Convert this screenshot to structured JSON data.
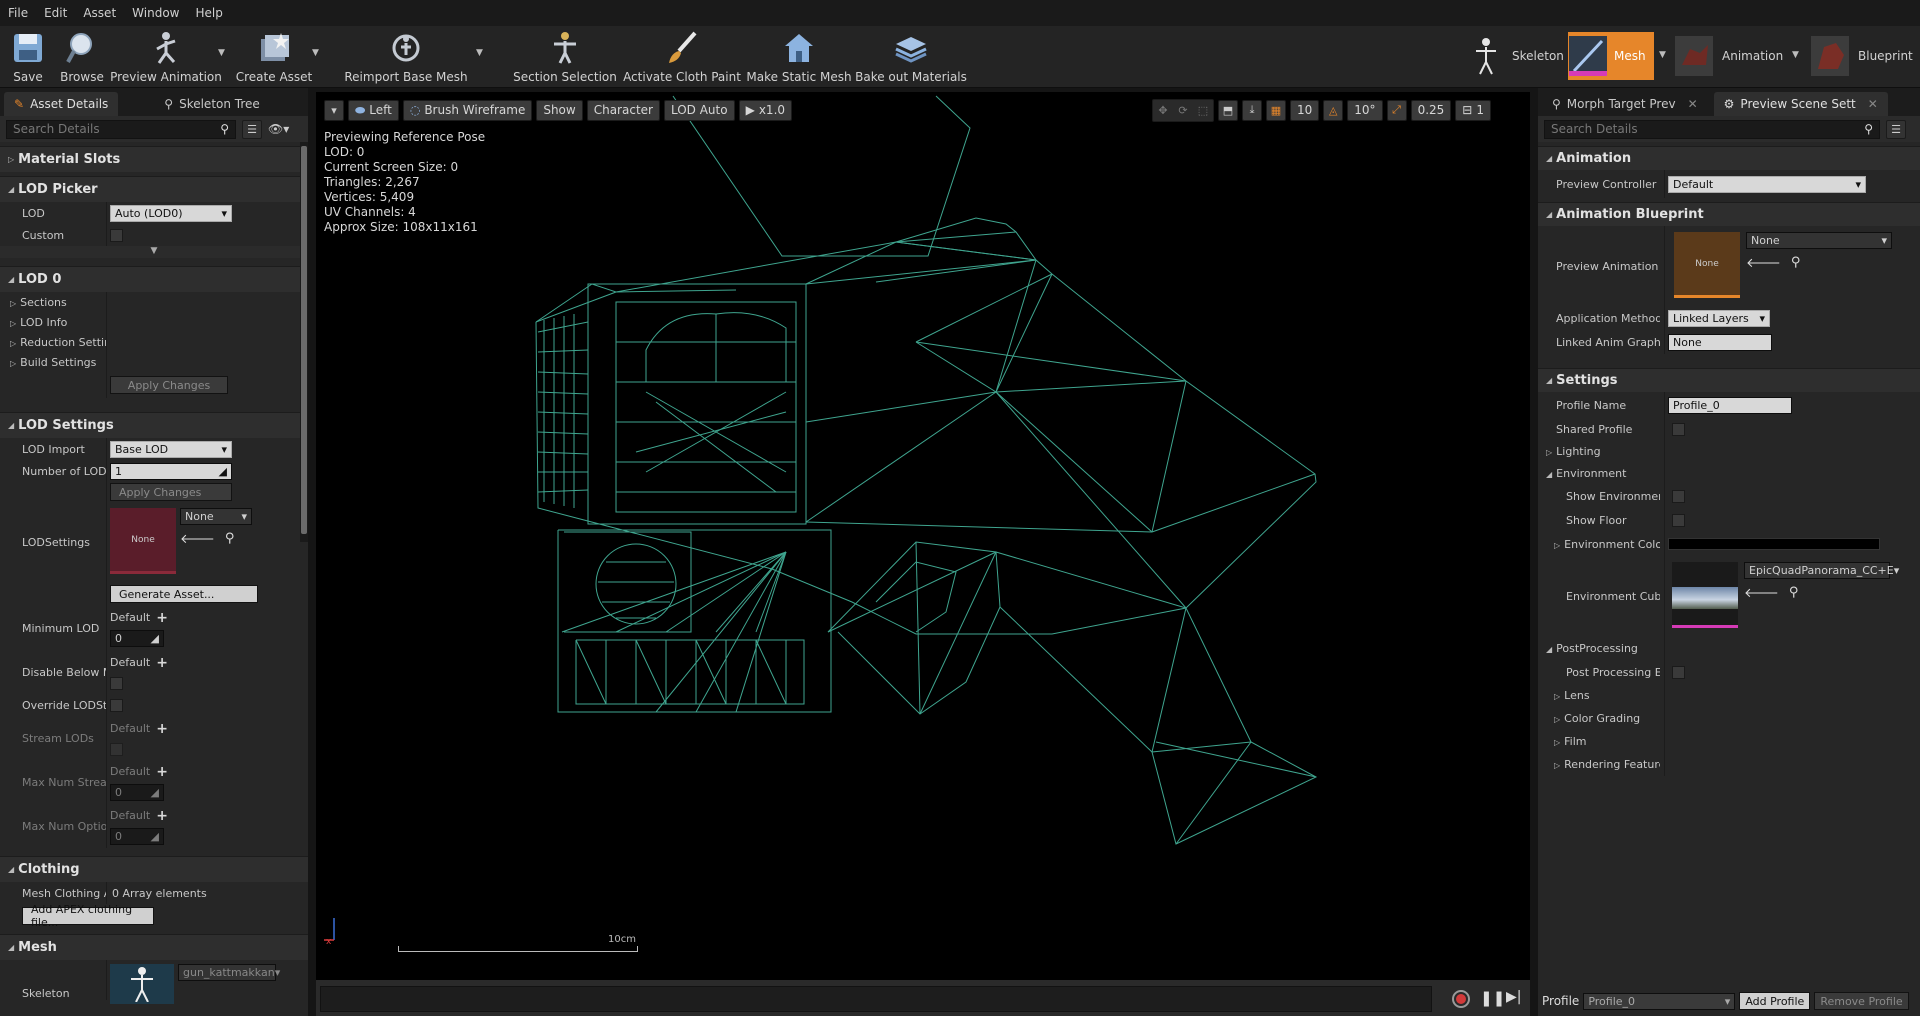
{
  "menu": [
    "File",
    "Edit",
    "Asset",
    "Window",
    "Help"
  ],
  "toolbar": {
    "save": "Save",
    "browse": "Browse",
    "preview_animation": "Preview Animation",
    "create_asset": "Create Asset",
    "reimport_base_mesh": "Reimport Base Mesh",
    "section_selection": "Section Selection",
    "activate_cloth_paint": "Activate Cloth Paint",
    "make_static_mesh": "Make Static Mesh",
    "bake_out_materials": "Bake out Materials"
  },
  "modes": {
    "skeleton": "Skeleton",
    "mesh": "Mesh",
    "animation": "Animation",
    "blueprint": "Blueprint"
  },
  "left": {
    "tabs": [
      "Asset Details",
      "Skeleton Tree"
    ],
    "search_placeholder": "Search Details",
    "material_slots": "Material Slots",
    "lod_picker": "LOD Picker",
    "lod_label": "LOD",
    "lod_value": "Auto (LOD0)",
    "custom_label": "Custom",
    "lod0": "LOD 0",
    "sections": "Sections",
    "lod_info": "LOD Info",
    "reduction_settings": "Reduction Settin",
    "build_settings": "Build Settings",
    "apply_changes": "Apply Changes",
    "lod_settings": "LOD Settings",
    "lod_import": "LOD Import",
    "lod_import_value": "Base LOD",
    "number_of_lods": "Number of LODs",
    "number_of_lods_value": "1",
    "apply_changes_2": "Apply Changes",
    "lodsettings": "LODSettings",
    "lodsettings_thumb": "None",
    "lodsettings_combo": "None",
    "generate_asset": "Generate Asset...",
    "minimum_lod": "Minimum LOD",
    "default": "Default",
    "minimum_lod_value": "0",
    "disable_below": "Disable Below M",
    "override_lodstr": "Override LODStr",
    "stream_lods": "Stream LODs",
    "max_num_stream": "Max Num Strean",
    "max_num_stream_value": "0",
    "max_num_optio": "Max Num Optior",
    "max_num_optio_value": "0",
    "clothing": "Clothing",
    "mesh_clothing": "Mesh Clothing A",
    "array_elements": "0 Array elements",
    "add_apex": "Add APEX clothing file...",
    "mesh": "Mesh",
    "skeleton": "Skeleton",
    "skeleton_value": "gun_kattmakkan"
  },
  "viewport": {
    "view_mode": "Left",
    "wireframe": "Brush Wireframe",
    "show": "Show",
    "character": "Character",
    "lod_auto": "LOD Auto",
    "speed": "x1.0",
    "grid_snap": "10",
    "rot_snap": "10°",
    "scale_snap": "0.25",
    "cam_speed": "1",
    "stats": [
      "Previewing Reference Pose",
      "LOD: 0",
      "Current Screen Size: 0",
      "Triangles: 2,267",
      "Vertices: 5,409",
      "UV Channels: 4",
      "Approx Size: 108x11x161"
    ],
    "scale_label": "10cm"
  },
  "right": {
    "tabs": [
      "Morph Target Prev",
      "Preview Scene Sett"
    ],
    "search_placeholder": "Search Details",
    "animation": "Animation",
    "preview_controller": "Preview Controller",
    "preview_controller_value": "Default",
    "animation_blueprint": "Animation Blueprint",
    "preview_anim_bp": "Preview Animation Blu",
    "anim_thumb": "None",
    "anim_combo": "None",
    "application_method": "Application Method",
    "application_method_value": "Linked Layers",
    "linked_anim_graph": "Linked Anim Graph Ta",
    "linked_anim_graph_value": "None",
    "settings": "Settings",
    "profile_name": "Profile Name",
    "profile_name_value": "Profile_0",
    "shared_profile": "Shared Profile",
    "lighting": "Lighting",
    "environment": "Environment",
    "show_environment": "Show Environment",
    "show_floor": "Show Floor",
    "environment_color": "Environment Color",
    "environment_cube": "Environment Cube M",
    "environment_cube_value": "EpicQuadPanorama_CC+E",
    "postprocessing": "PostProcessing",
    "post_processing_enabled": "Post Processing Ena",
    "lens": "Lens",
    "color_grading": "Color Grading",
    "film": "Film",
    "rendering_features": "Rendering Features",
    "profile_label": "Profile",
    "profile_value": "Profile_0",
    "add_profile": "Add Profile",
    "remove_profile": "Remove Profile"
  },
  "colors": {
    "accent": "#e6862a",
    "wire": "#3fa58f",
    "viewport_bg": "#000000"
  }
}
